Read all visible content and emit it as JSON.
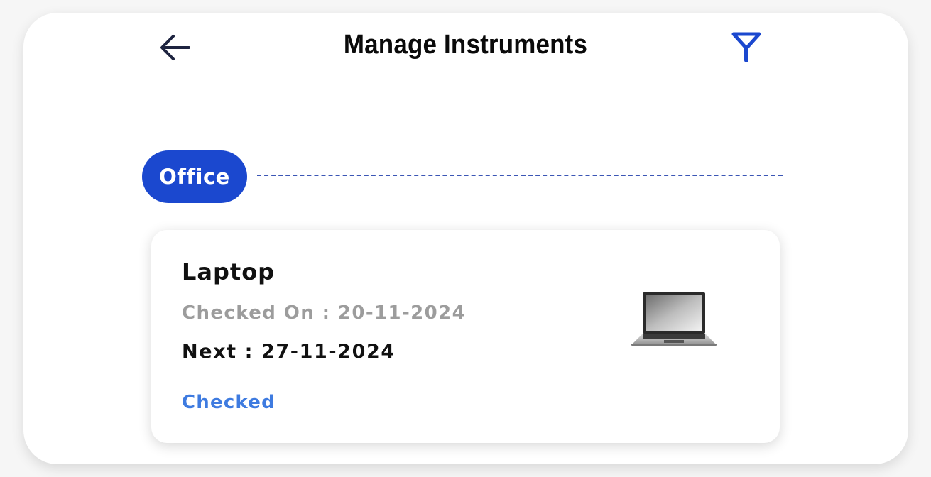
{
  "header": {
    "title": "Manage Instruments",
    "back_icon": "arrow-left-icon",
    "filter_icon": "filter-icon"
  },
  "group": {
    "label": "Office"
  },
  "instrument": {
    "name": "Laptop",
    "checked_on": "Checked On : 20-11-2024",
    "next": "Next : 27-11-2024",
    "status": "Checked",
    "image_icon": "laptop-icon"
  },
  "colors": {
    "accent": "#1b48cf",
    "status": "#3e7be0",
    "muted": "#9c9c9c"
  }
}
